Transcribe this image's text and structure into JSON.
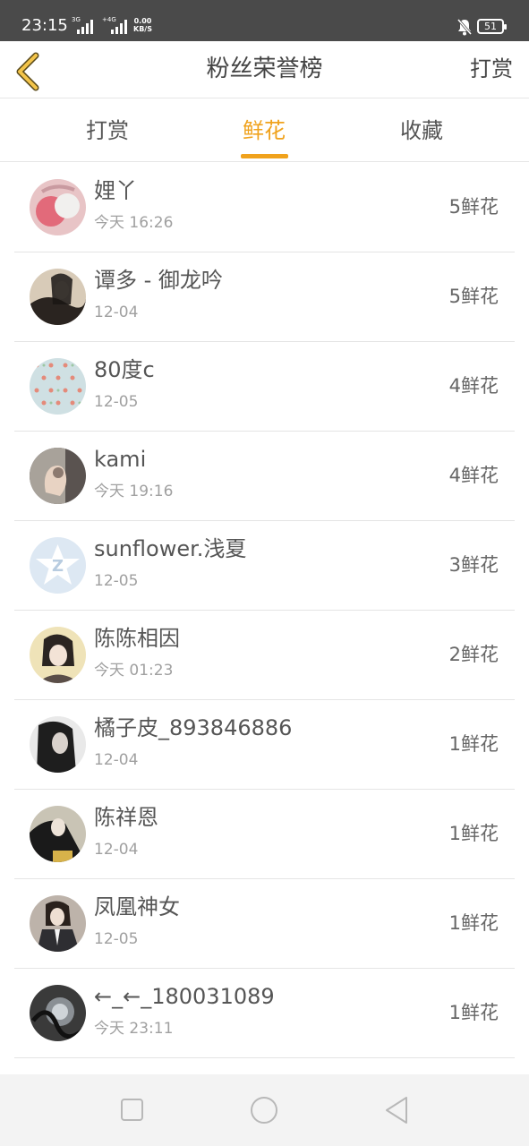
{
  "status_bar": {
    "time": "23:15",
    "signal1_tag": "3G",
    "signal2_tag": "+4G",
    "net_speed_value": "0.00",
    "net_speed_unit": "KB/S",
    "battery": "51",
    "icons": [
      "signal-icon",
      "signal-icon",
      "bell-off-icon",
      "battery-icon"
    ]
  },
  "header": {
    "title": "粉丝荣誉榜",
    "action": "打赏",
    "accent_color": "#f0a21c"
  },
  "tabs": [
    {
      "label": "打赏",
      "active": false
    },
    {
      "label": "鲜花",
      "active": true
    },
    {
      "label": "收藏",
      "active": false
    }
  ],
  "fans": [
    {
      "name": "娌丫",
      "time": "今天 16:26",
      "count": "5鲜花"
    },
    {
      "name": "谭多 - 御龙吟",
      "time": "12-04",
      "count": "5鲜花"
    },
    {
      "name": "80度c",
      "time": "12-05",
      "count": "4鲜花"
    },
    {
      "name": "kami",
      "time": "今天 19:16",
      "count": "4鲜花"
    },
    {
      "name": "sunflower.浅夏",
      "time": "12-05",
      "count": "3鲜花"
    },
    {
      "name": "陈陈相因",
      "time": "今天 01:23",
      "count": "2鲜花"
    },
    {
      "name": "橘子皮_893846886",
      "time": "12-04",
      "count": "1鲜花"
    },
    {
      "name": "陈祥恩",
      "time": "12-04",
      "count": "1鲜花"
    },
    {
      "name": "凤凰神女",
      "time": "12-05",
      "count": "1鲜花"
    },
    {
      "name": "←_←_180031089",
      "time": "今天 23:11",
      "count": "1鲜花"
    }
  ],
  "nav_bar": {
    "icons": [
      "recent-apps-icon",
      "home-icon",
      "back-triangle-icon"
    ]
  }
}
